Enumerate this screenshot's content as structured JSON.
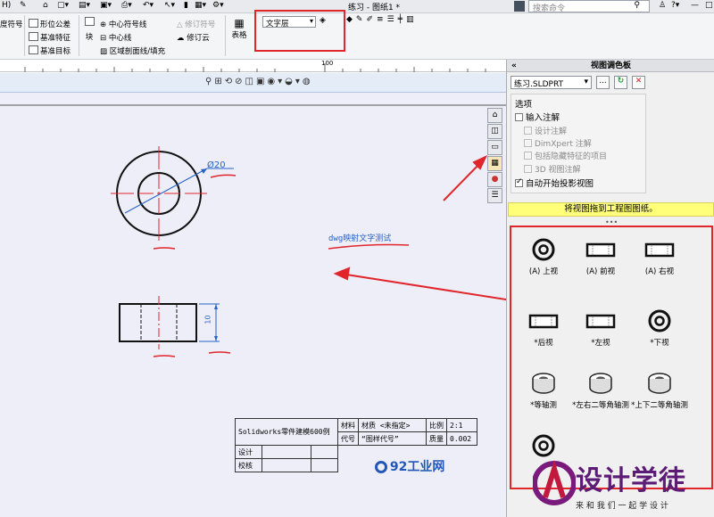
{
  "titlebar": {
    "left_fragment": "H)",
    "document_title": "练习 - 图纸1 *",
    "search_placeholder": "搜索命令"
  },
  "ribbon": {
    "col1_item": "度符号",
    "col2_items": [
      "形位公差",
      "基准特征",
      "基准目标"
    ],
    "block_label": "块",
    "col3_items": [
      "中心符号线",
      "中心线",
      "区域剖面线/填充"
    ],
    "col4_items": [
      "修订符号",
      "修订云"
    ],
    "table_label": "表格",
    "layer_select": "文字层"
  },
  "ruler": {
    "mark_100": "100"
  },
  "drawing": {
    "diameter_label": "Ø20",
    "height_label": "10",
    "dwg_text": "dwg映射文字测试"
  },
  "title_block": {
    "model_name": "Solidworks零件建模600例",
    "material_label": "材料",
    "material_value": "材质 <未指定>",
    "scale_label": "比例",
    "scale_value": "2:1",
    "code_label": "代号",
    "code_value": "“图样代号”",
    "mass_label": "质量",
    "mass_value": "0.002",
    "design_label": "设计",
    "check_label": "校核"
  },
  "watermark": {
    "logo_92": "92工业网",
    "brand": "设计学徒",
    "slogan": "来 和 我 们 一 起 学 设 计"
  },
  "view_palette": {
    "title": "视图调色板",
    "collapse": "«",
    "file_select": "练习.SLDPRT",
    "browse_button": "...",
    "options_label": "选项",
    "import_annotations": "输入注解",
    "design_annotations": "设计注解",
    "dimxpert_annotations": "DimXpert 注解",
    "hidden_features": "包括隐藏特征的项目",
    "3d_annotations": "3D 视图注解",
    "auto_projection": "自动开始投影视图",
    "drag_hint": "将视图拖到工程图图纸。",
    "views": [
      {
        "label": "(A) 上视",
        "icon": "ring"
      },
      {
        "label": "(A) 前视",
        "icon": "rect"
      },
      {
        "label": "(A) 右视",
        "icon": "rect"
      },
      {
        "label": "*后视",
        "icon": "rect"
      },
      {
        "label": "*左视",
        "icon": "rect"
      },
      {
        "label": "*下视",
        "icon": "ring"
      },
      {
        "label": "*等轴测",
        "icon": "iso"
      },
      {
        "label": "*左右二等角轴测",
        "icon": "iso"
      },
      {
        "label": "*上下二等角轴测",
        "icon": "iso"
      },
      {
        "label": "",
        "icon": "ring"
      }
    ]
  },
  "colors": {
    "red_highlight": "#e0262b",
    "sketch_red": "#e0262b",
    "dim_blue": "#2563c7",
    "hint_yellow": "#ffff7a",
    "sheet_bg": "#eeeef8"
  }
}
